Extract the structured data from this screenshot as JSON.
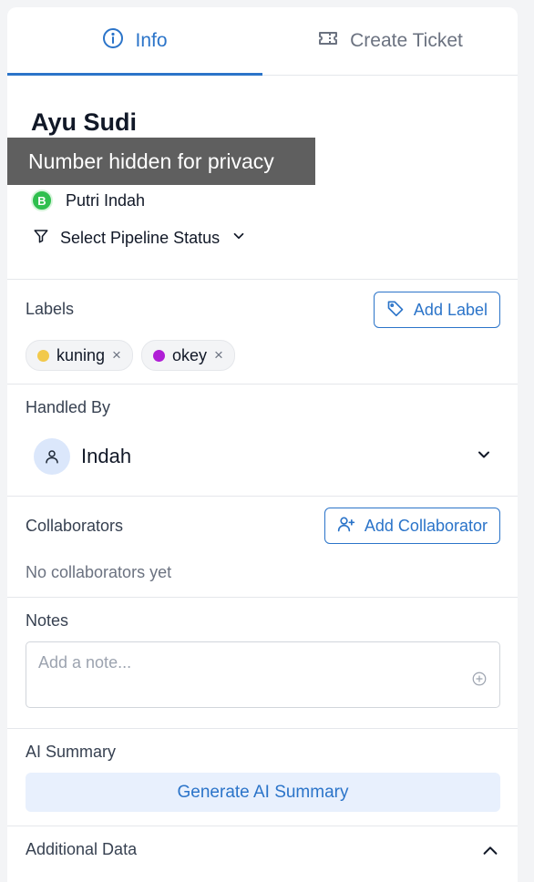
{
  "tabs": [
    {
      "label": "Info",
      "icon": "info-circle-icon",
      "active": true
    },
    {
      "label": "Create Ticket",
      "icon": "ticket-icon",
      "active": false
    }
  ],
  "contact": {
    "name": "Ayu Sudi",
    "privacy_text": "Number hidden for privacy",
    "channel_name": "Putri Indah",
    "channel_badge": "B",
    "pipeline_label": "Select Pipeline Status"
  },
  "labels": {
    "title": "Labels",
    "add_button": "Add Label",
    "items": [
      {
        "text": "kuning",
        "color": "#f2c94c"
      },
      {
        "text": "okey",
        "color": "#b01ed6"
      }
    ],
    "remove_glyph": "×"
  },
  "handled_by": {
    "title": "Handled By",
    "agent": "Indah"
  },
  "collaborators": {
    "title": "Collaborators",
    "add_button": "Add Collaborator",
    "empty_text": "No collaborators yet"
  },
  "notes": {
    "title": "Notes",
    "placeholder": "Add a note..."
  },
  "ai_summary": {
    "title": "AI Summary",
    "button": "Generate AI Summary"
  },
  "additional_data": {
    "title": "Additional Data"
  },
  "colors": {
    "accent": "#2b74c9",
    "whatsapp": "#2fbf4e"
  }
}
